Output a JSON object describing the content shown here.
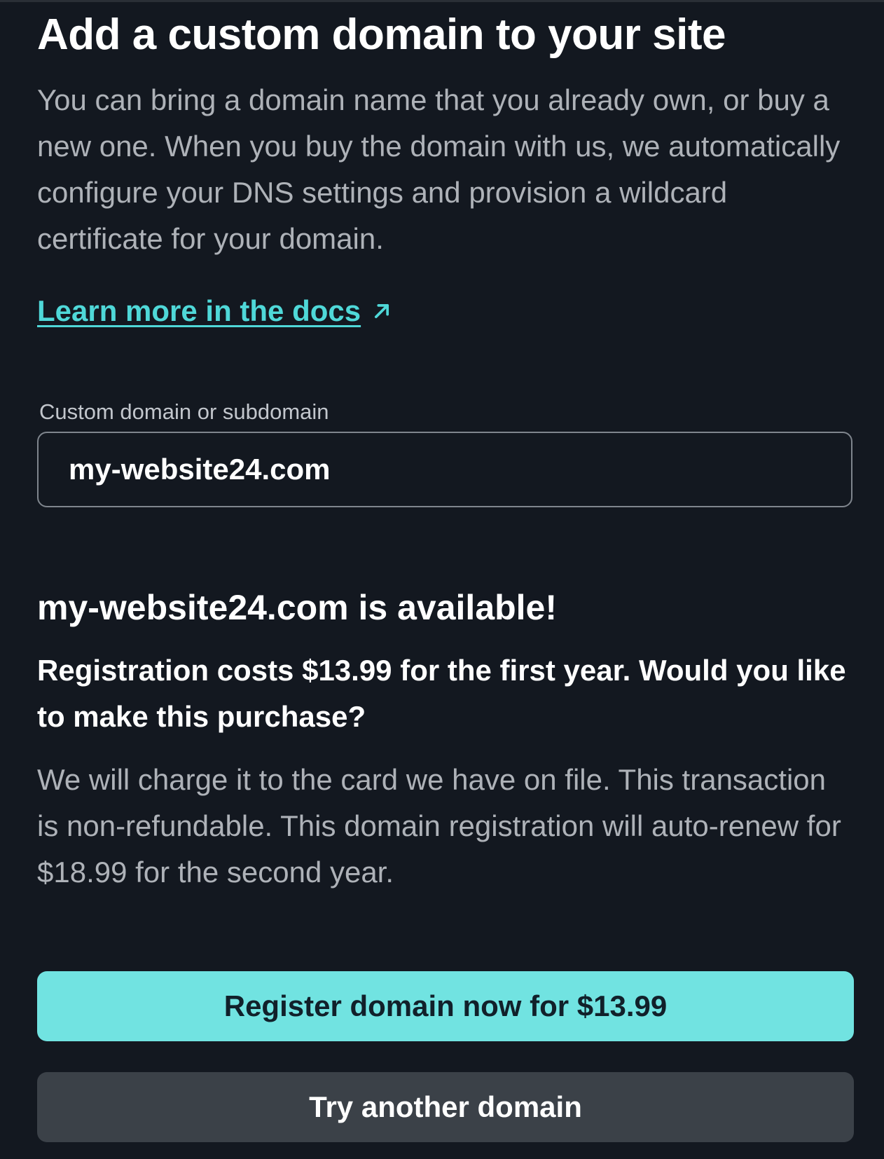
{
  "header": {
    "title": "Add a custom domain to your site"
  },
  "intro": {
    "text": "You can bring a domain name that you already own, or buy a new one. When you buy the domain with us, we automatically configure your DNS settings and provision a wildcard certificate for your domain."
  },
  "docs_link": {
    "label": "Learn more in the docs",
    "icon": "external-arrow-icon"
  },
  "domain_field": {
    "label": "Custom domain or subdomain",
    "value": "my-website24.com"
  },
  "result": {
    "heading": "my-website24.com is available!",
    "question": "Registration costs $13.99 for the first year. Would you like to make this purchase?",
    "note": "We will charge it to the card we have on file. This transaction is non-refundable. This domain registration will auto-renew for $18.99 for the second year."
  },
  "actions": {
    "register_label": "Register domain now for $13.99",
    "try_another_label": "Try another domain"
  },
  "colors": {
    "background": "#131820",
    "accent": "#71e3e1",
    "link": "#4fd8d8",
    "secondary_button": "#3b4148"
  }
}
